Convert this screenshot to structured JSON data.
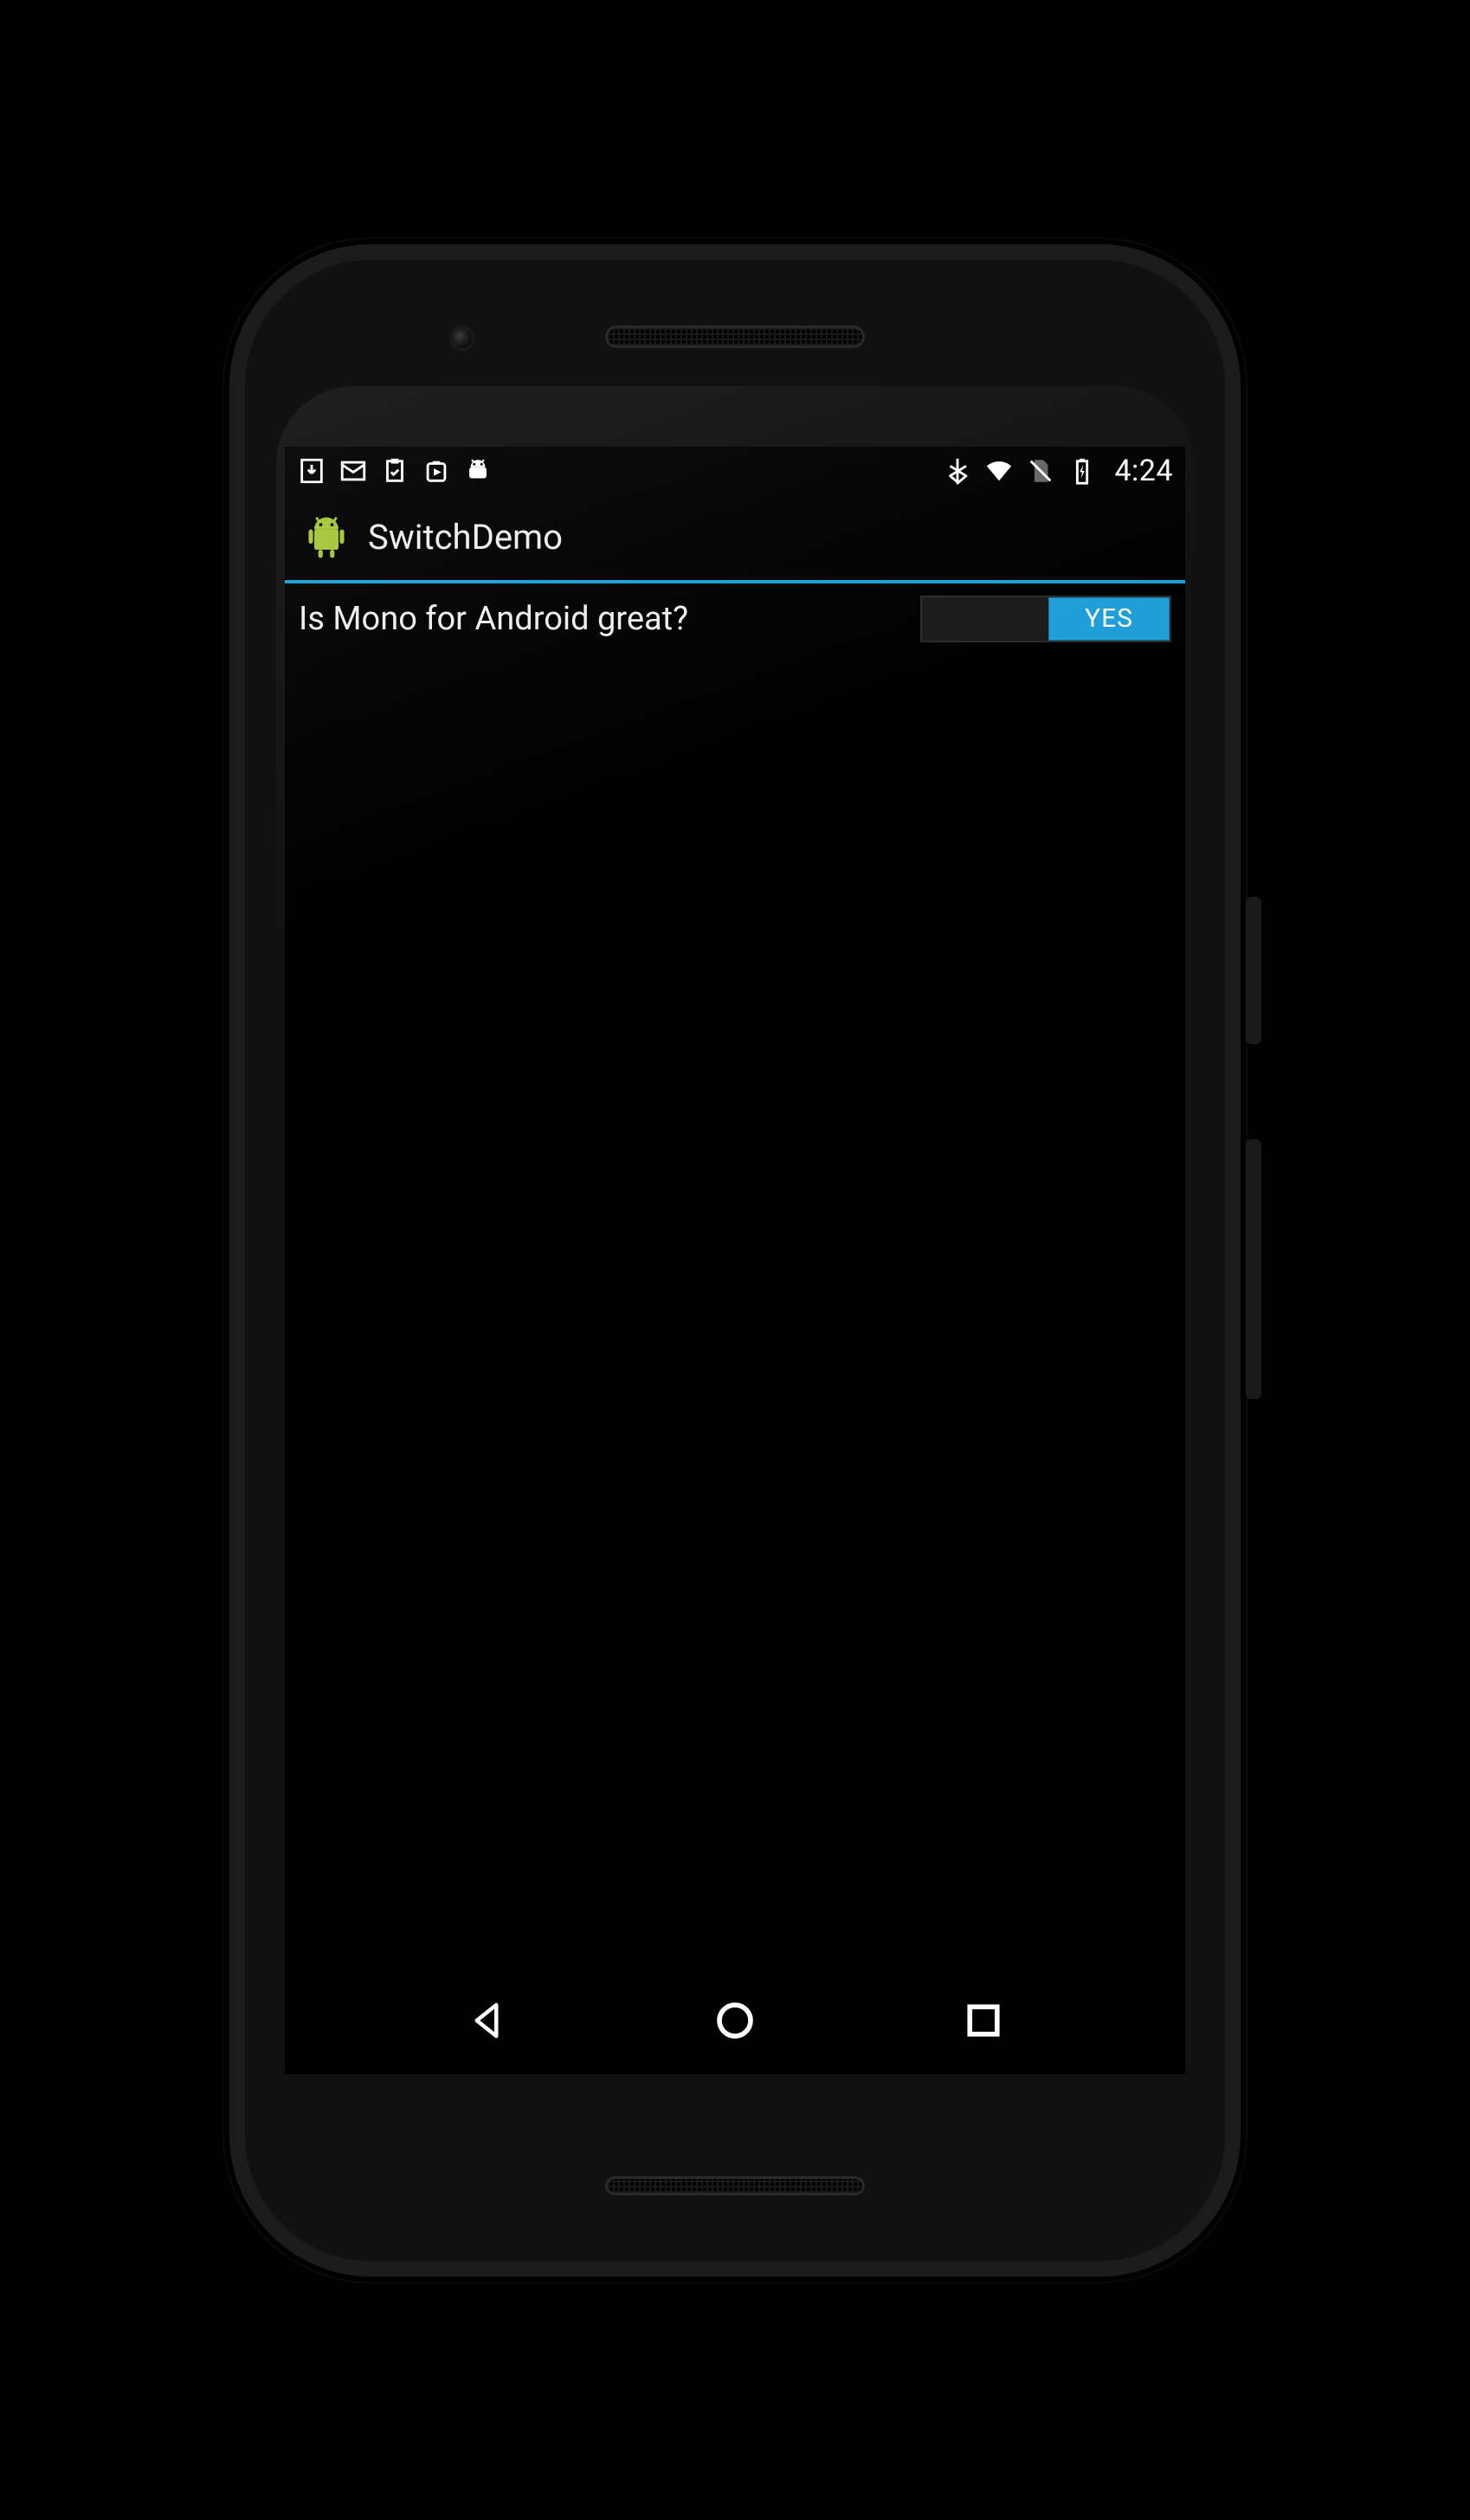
{
  "statusbar": {
    "icons_left": [
      "download-icon",
      "mail-icon",
      "clipboard-check-icon",
      "play-store-icon",
      "android-debug-icon"
    ],
    "icons_right": [
      "bluetooth-icon",
      "wifi-icon",
      "no-sim-icon",
      "battery-charging-icon"
    ],
    "clock": "4:24"
  },
  "actionbar": {
    "app_icon": "android-robot-icon",
    "title": "SwitchDemo"
  },
  "content": {
    "question_label": "Is Mono for Android great?",
    "switch": {
      "on_label": "YES",
      "state": "on"
    }
  },
  "navbar": {
    "buttons": [
      "back",
      "home",
      "recents"
    ]
  },
  "colors": {
    "accent": "#1f9ed8",
    "android_green": "#a4c639"
  }
}
